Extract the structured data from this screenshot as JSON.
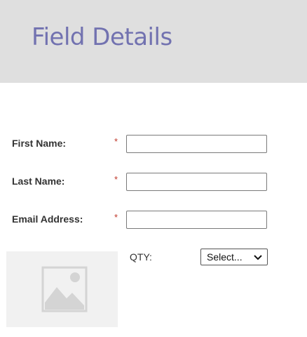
{
  "header": {
    "title": "Field Details",
    "background": "#dfdfdf",
    "title_color": "#7272b0"
  },
  "form": {
    "fields": [
      {
        "label": "First Name:",
        "required_mark": "*",
        "value": ""
      },
      {
        "label": "Last Name:",
        "required_mark": "*",
        "value": ""
      },
      {
        "label": "Email Address:",
        "required_mark": "*",
        "value": ""
      }
    ],
    "required_color": "#c0392b",
    "qty": {
      "label": "QTY:",
      "selected": "Select..."
    }
  },
  "image": {
    "icon": "image-placeholder-icon"
  }
}
